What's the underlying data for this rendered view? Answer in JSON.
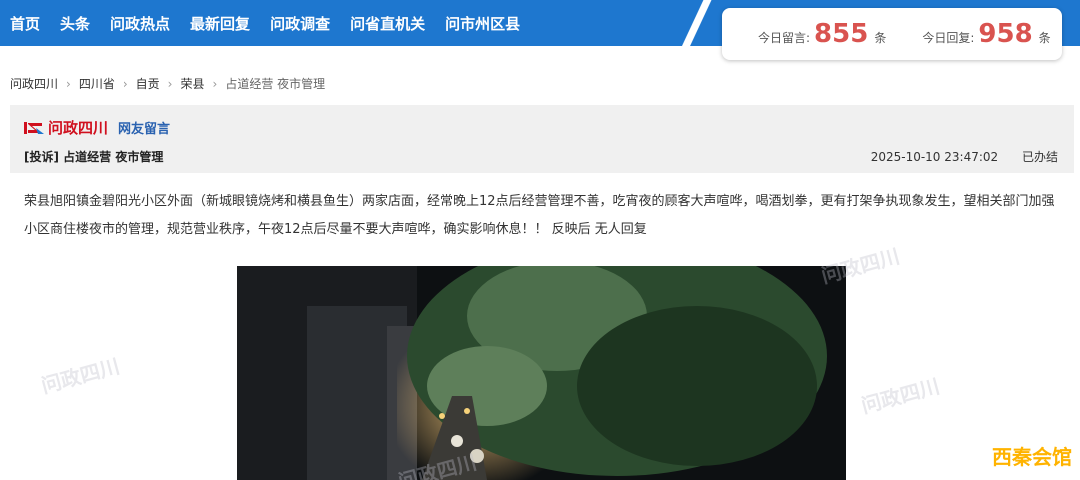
{
  "nav": {
    "items": [
      "首页",
      "头条",
      "问政热点",
      "最新回复",
      "问政调查",
      "问省直机关",
      "问市州区县"
    ]
  },
  "stats": {
    "today_messages_label": "今日留言:",
    "today_messages_value": "855",
    "today_messages_unit": "条",
    "today_replies_label": "今日回复:",
    "today_replies_value": "958",
    "today_replies_unit": "条"
  },
  "breadcrumb": [
    "问政四川",
    "四川省",
    "自贡",
    "荣县",
    "占道经营 夜市管理"
  ],
  "post": {
    "brand": "问政四川",
    "section": "网友留言",
    "title": "[投诉] 占道经营 夜市管理",
    "datetime": "2025-10-10 23:47:02",
    "status": "已办结",
    "body": "荣县旭阳镇金碧阳光小区外面（新城眼镜烧烤和横县鱼生）两家店面，经常晚上12点后经营管理不善，吃宵夜的顾客大声喧哗，喝酒划拳，更有打架争执现象发生，望相关部门加强小区商住楼夜市的管理，规范营业秩序，午夜12点后尽量不要大声喧哗，确实影响休息！！ 反映后 无人回复"
  },
  "watermark": "问政四川",
  "corner_logo": "西秦会馆",
  "colors": {
    "nav_bg": "#1E77CF",
    "brand_red": "#D0101E",
    "link_blue": "#2A62B0",
    "stat_red": "#D9534F"
  }
}
